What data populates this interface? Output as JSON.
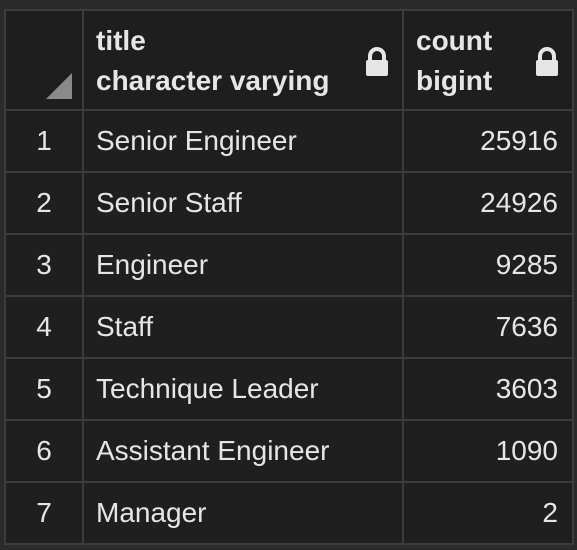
{
  "columns": [
    {
      "name": "title",
      "type": "character varying",
      "icon": "lock-icon"
    },
    {
      "name": "count",
      "type": "bigint",
      "icon": "lock-icon"
    }
  ],
  "rows": [
    {
      "num": "1",
      "title": "Senior Engineer",
      "count": "25916"
    },
    {
      "num": "2",
      "title": "Senior Staff",
      "count": "24926"
    },
    {
      "num": "3",
      "title": "Engineer",
      "count": "9285"
    },
    {
      "num": "4",
      "title": "Staff",
      "count": "7636"
    },
    {
      "num": "5",
      "title": "Technique Leader",
      "count": "3603"
    },
    {
      "num": "6",
      "title": "Assistant Engineer",
      "count": "1090"
    },
    {
      "num": "7",
      "title": "Manager",
      "count": "2"
    }
  ]
}
